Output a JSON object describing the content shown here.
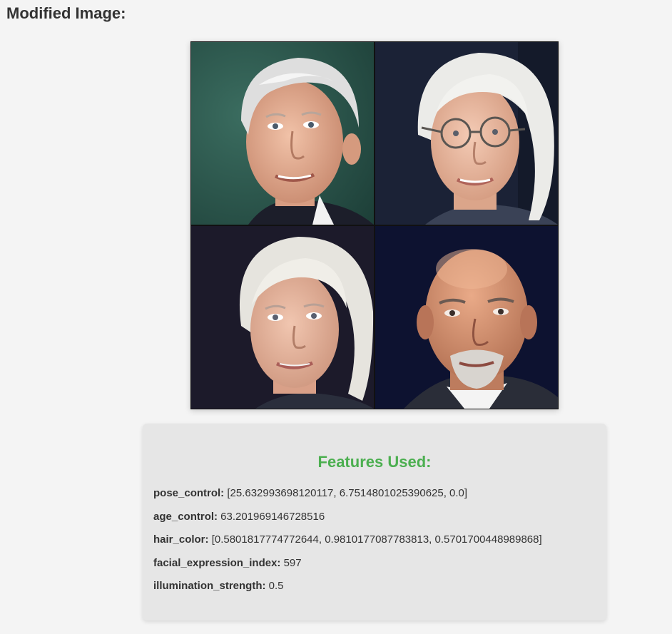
{
  "page": {
    "title": "Modified Image:"
  },
  "image_grid": {
    "tiles": [
      {
        "name": "face-tile-top-left",
        "bg": "#2c5a4e",
        "skin": "#e8b196",
        "hair": "#dcdcdc",
        "shirt": "#1c1e2a"
      },
      {
        "name": "face-tile-top-right",
        "bg": "#1b2236",
        "skin": "#ecbfa6",
        "hair": "#e9e9e6",
        "shirt": "#3a4256"
      },
      {
        "name": "face-tile-bottom-left",
        "bg": "#1c1a2a",
        "skin": "#e7b59e",
        "hair": "#e4e2dc",
        "shirt": "#2a2e3c"
      },
      {
        "name": "face-tile-bottom-right",
        "bg": "#0d1230",
        "skin": "#cf8f6e",
        "hair": "#c98a6a",
        "shirt": "#2a2d38"
      }
    ]
  },
  "features": {
    "title": "Features Used:",
    "items": [
      {
        "key": "pose_control:",
        "value": " [25.632993698120117, 6.7514801025390625, 0.0]"
      },
      {
        "key": "age_control:",
        "value": " 63.201969146728516"
      },
      {
        "key": "hair_color:",
        "value": " [0.5801817774772644, 0.9810177087783813, 0.5701700448989868]"
      },
      {
        "key": "facial_expression_index:",
        "value": " 597"
      },
      {
        "key": "illumination_strength:",
        "value": " 0.5"
      }
    ]
  },
  "colors": {
    "background": "#f4f4f4",
    "panel": "#e6e6e6",
    "accent_green": "#4caf50",
    "text": "#333333"
  }
}
